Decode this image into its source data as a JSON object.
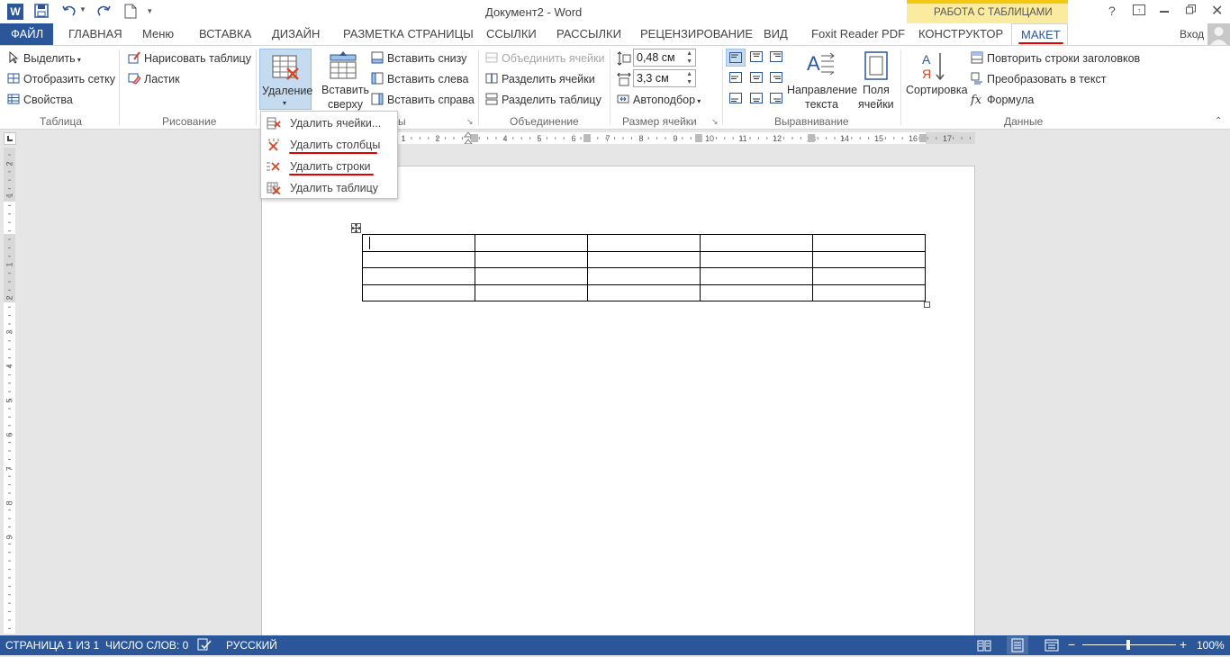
{
  "titlebar": {
    "document_title": "Документ2 - Word",
    "context_group": "РАБОТА С ТАБЛИЦАМИ",
    "help": "?"
  },
  "tabs": {
    "file": "ФАЙЛ",
    "items": [
      "ГЛАВНАЯ",
      "Меню",
      "ВСТАВКА",
      "ДИЗАЙН",
      "РАЗМЕТКА СТРАНИЦЫ",
      "ССЫЛКИ",
      "РАССЫЛКИ",
      "РЕЦЕНЗИРОВАНИЕ",
      "ВИД",
      "Foxit Reader PDF",
      "КОНСТРУКТОР",
      "МАКЕТ"
    ],
    "active": "МАКЕТ",
    "signin": "Вход"
  },
  "ribbon": {
    "table_group": {
      "label": "Таблица",
      "select": "Выделить",
      "gridlines": "Отобразить сетку",
      "properties": "Свойства"
    },
    "draw_group": {
      "label": "Рисование",
      "draw_table": "Нарисовать таблицу",
      "eraser": "Ластик"
    },
    "rows_cols_group": {
      "delete": "Удаление",
      "insert_above_1": "Вставить",
      "insert_above_2": "сверху",
      "insert_below": "Вставить снизу",
      "insert_left": "Вставить слева",
      "insert_right": "Вставить справа",
      "label_tail": "ы"
    },
    "merge_group": {
      "label": "Объединение",
      "merge_cells": "Объединить ячейки",
      "split_cells": "Разделить ячейки",
      "split_table": "Разделить таблицу"
    },
    "cell_size_group": {
      "label": "Размер ячейки",
      "height": "0,48 см",
      "width": "3,3 см",
      "autofit": "Автоподбор"
    },
    "align_group": {
      "label": "Выравнивание",
      "text_direction_1": "Направление",
      "text_direction_2": "текста",
      "cell_margins_1": "Поля",
      "cell_margins_2": "ячейки"
    },
    "data_group": {
      "label": "Данные",
      "sort": "Сортировка",
      "repeat_header": "Повторить строки заголовков",
      "convert_to_text": "Преобразовать в текст",
      "formula": "Формула"
    }
  },
  "delete_menu": {
    "items": [
      "Удалить ячейки...",
      "Удалить столбцы",
      "Удалить строки",
      "Удалить таблицу"
    ],
    "highlight_color": "#e00000"
  },
  "ruler": {
    "top_numbers": [
      "1",
      "2",
      "4",
      "5",
      "6",
      "7",
      "8",
      "9",
      "10",
      "11",
      "12",
      "13",
      "14",
      "15",
      "16",
      "17"
    ],
    "left_numbers": [
      "2",
      "1",
      "1",
      "2",
      "3",
      "4",
      "5",
      "6",
      "7",
      "8",
      "9"
    ]
  },
  "table": {
    "rows": 4,
    "cols": 5
  },
  "status": {
    "page": "СТРАНИЦА 1 ИЗ 1",
    "words": "ЧИСЛО СЛОВ: 0",
    "language": "РУССКИЙ",
    "zoom": "100%",
    "zoom_minus": "−",
    "zoom_plus": "+"
  },
  "colors": {
    "word_blue": "#2b579a",
    "context_yellow": "#fbeb9e",
    "annotation_red": "#e00000"
  }
}
